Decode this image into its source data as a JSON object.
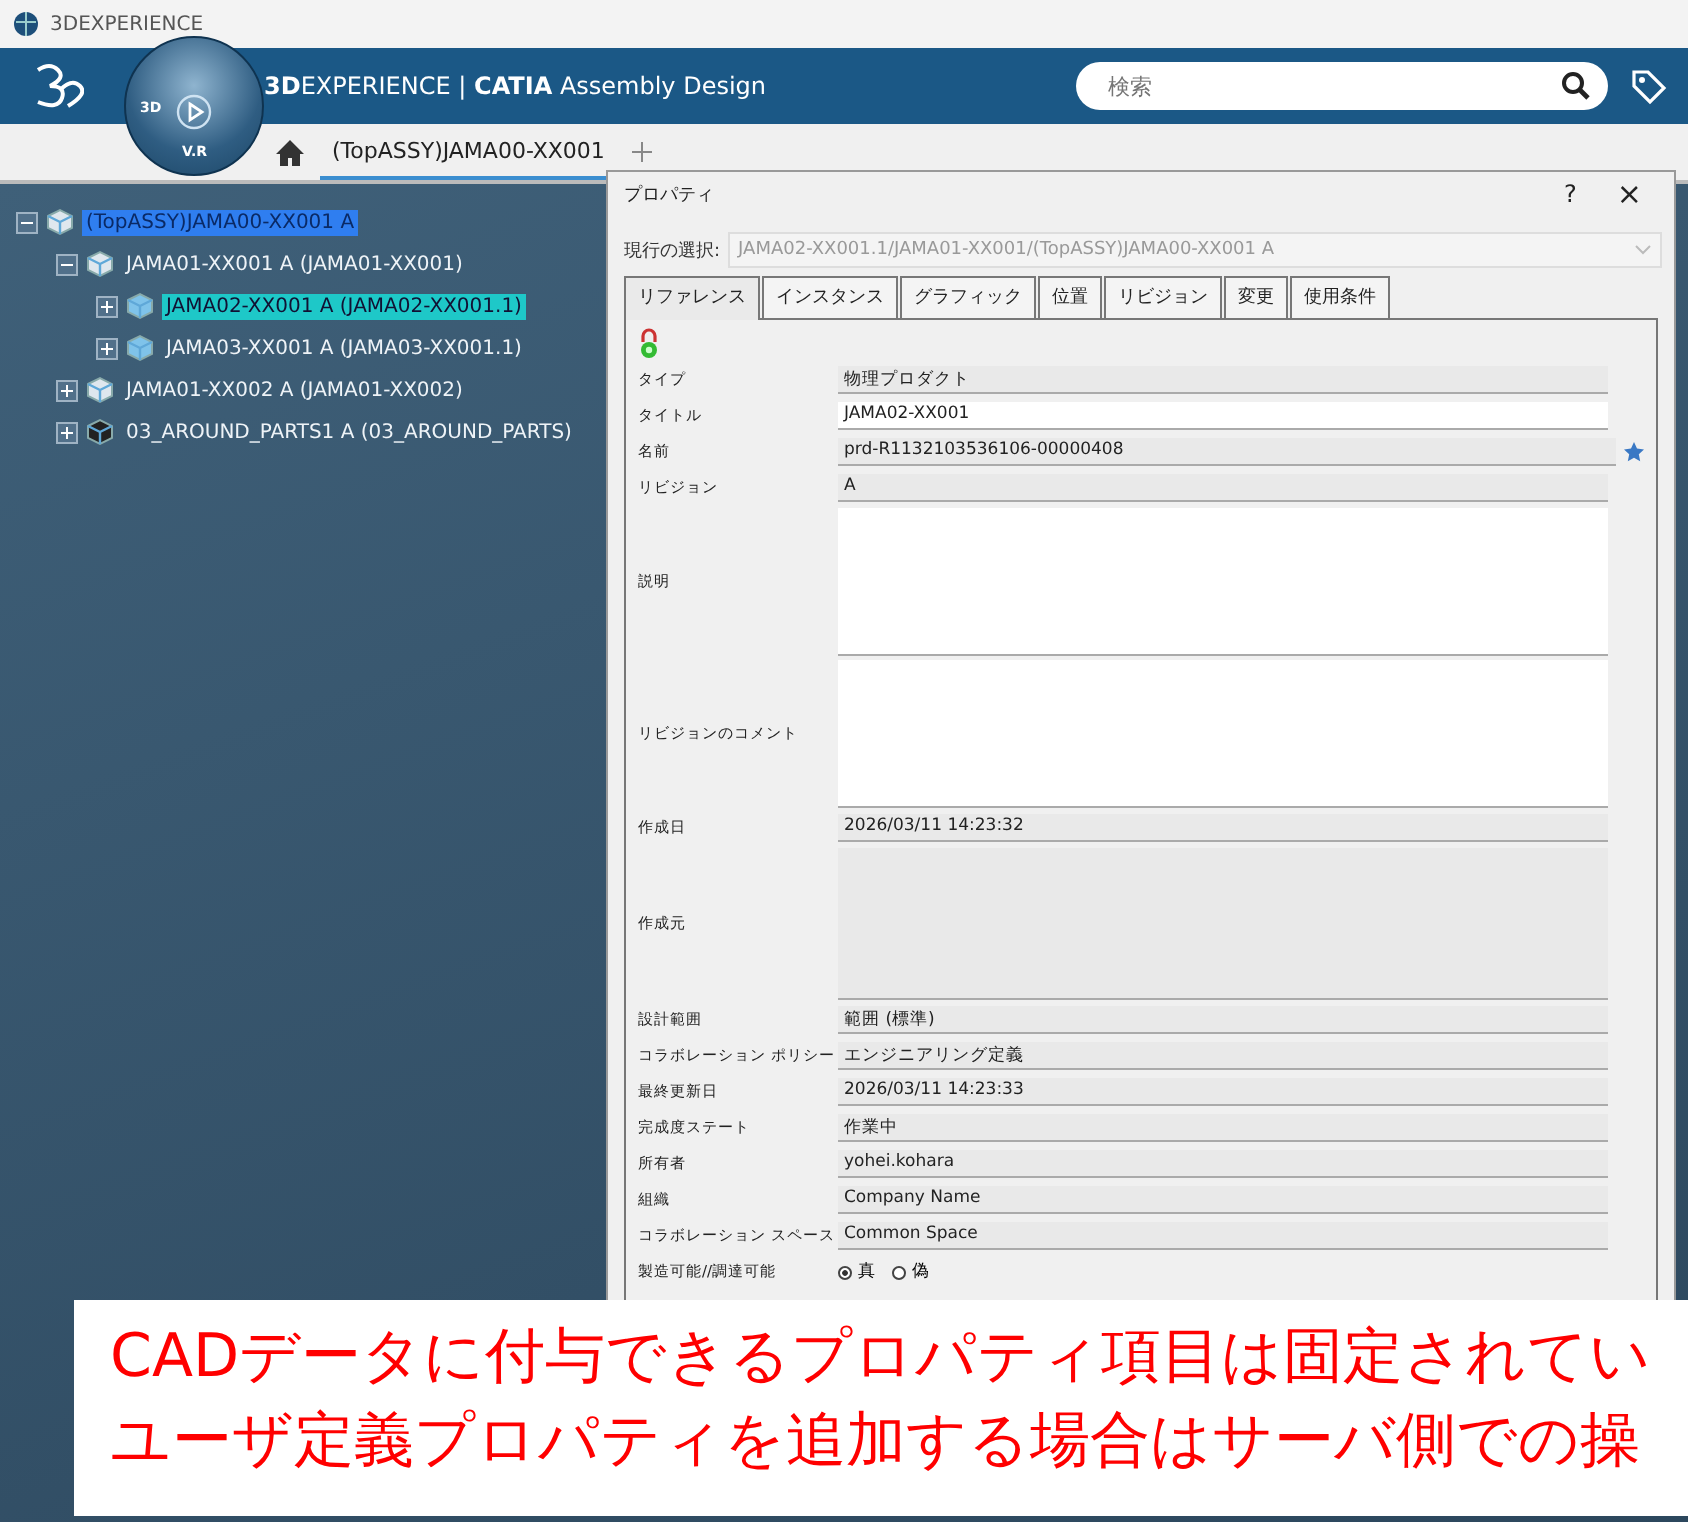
{
  "window": {
    "title": "3DEXPERIENCE"
  },
  "header": {
    "app_title": "**3D**EXPERIENCE | **CATIA** Assembly Design",
    "compass_labels": [
      "3D",
      "V.R"
    ],
    "search": {
      "placeholder": "検索"
    }
  },
  "tabs": [
    {
      "label": "(TopASSY)JAMA00-XX001",
      "selected": true
    }
  ],
  "tree": [
    {
      "label": "(TopASSY)JAMA00-XX001 A",
      "kind": "assembly",
      "expanded": true,
      "editing": true,
      "selected": false,
      "children": [
        {
          "label": "JAMA01-XX001 A (JAMA01-XX001)",
          "kind": "assembly",
          "expanded": true,
          "editing": false,
          "selected": false,
          "children": [
            {
              "label": "JAMA02-XX001 A (JAMA02-XX001.1)",
              "kind": "part",
              "expanded": false,
              "editing": false,
              "selected": true
            },
            {
              "label": "JAMA03-XX001 A (JAMA03-XX001.1)",
              "kind": "part",
              "expanded": false,
              "editing": false,
              "selected": false
            }
          ]
        },
        {
          "label": "JAMA01-XX002 A (JAMA01-XX002)",
          "kind": "assembly",
          "expanded": false,
          "editing": false,
          "selected": false
        },
        {
          "label": "03_AROUND_PARTS1 A (03_AROUND_PARTS)",
          "kind": "black",
          "expanded": false,
          "editing": false,
          "selected": false
        }
      ]
    }
  ],
  "dialog": {
    "title": "プロパティ",
    "help": "?",
    "close": "×",
    "selection_label": "現行の選択:",
    "selection_value": "JAMA02-XX001.1/JAMA01-XX001/(TopASSY)JAMA00-XX001 A",
    "tabs": [
      {
        "label": "リファレンス",
        "selected": true
      },
      {
        "label": "インスタンス",
        "selected": false
      },
      {
        "label": "グラフィック",
        "selected": false
      },
      {
        "label": "位置",
        "selected": false
      },
      {
        "label": "リビジョン",
        "selected": false
      },
      {
        "label": "変更",
        "selected": false
      },
      {
        "label": "使用条件",
        "selected": false
      }
    ],
    "locked": true,
    "rows": [
      {
        "kind": "field",
        "label": "タイプ",
        "value": "物理プロダクト",
        "editable": false
      },
      {
        "kind": "field",
        "label": "タイトル",
        "value": "JAMA02-XX001",
        "editable": true
      },
      {
        "kind": "field",
        "label": "名前",
        "value": "prd-R1132103536106-00000408",
        "editable": false,
        "starred": true
      },
      {
        "kind": "field",
        "label": "リビジョン",
        "value": "A",
        "editable": false
      },
      {
        "kind": "area",
        "label": "説明",
        "editable": true
      },
      {
        "kind": "area",
        "label": "リビジョンのコメント",
        "editable": true
      },
      {
        "kind": "field",
        "label": "作成日",
        "value": "2026/03/11 14:23:32",
        "editable": false
      },
      {
        "kind": "area",
        "label": "作成元",
        "editable": false
      },
      {
        "kind": "field",
        "label": "設計範囲",
        "value": "範囲 (標準)",
        "editable": false
      },
      {
        "kind": "field",
        "label": "コラボレーション ポリシー",
        "value": "エンジニアリング定義",
        "editable": false
      },
      {
        "kind": "field",
        "label": "最終更新日",
        "value": "2026/03/11 14:23:33",
        "editable": false
      },
      {
        "kind": "field",
        "label": "完成度ステート",
        "value": "作業中",
        "editable": false
      },
      {
        "kind": "field",
        "label": "所有者",
        "value": "yohei.kohara",
        "editable": false
      },
      {
        "kind": "field",
        "label": "組織",
        "value": "Company Name",
        "editable": false
      },
      {
        "kind": "field",
        "label": "コラボレーション スペース",
        "value": "Common Space",
        "editable": false
      },
      {
        "kind": "radio",
        "label": "製造可能//調達可能",
        "options": [
          {
            "label": "真",
            "selected": true
          },
          {
            "label": "偽",
            "selected": false
          }
        ]
      }
    ]
  },
  "annotation": {
    "lines": [
      "CADデータに付与できるプロパティ項目は固定されてい",
      "ユーザ定義プロパティを追加する場合はサーバ側での操"
    ]
  }
}
